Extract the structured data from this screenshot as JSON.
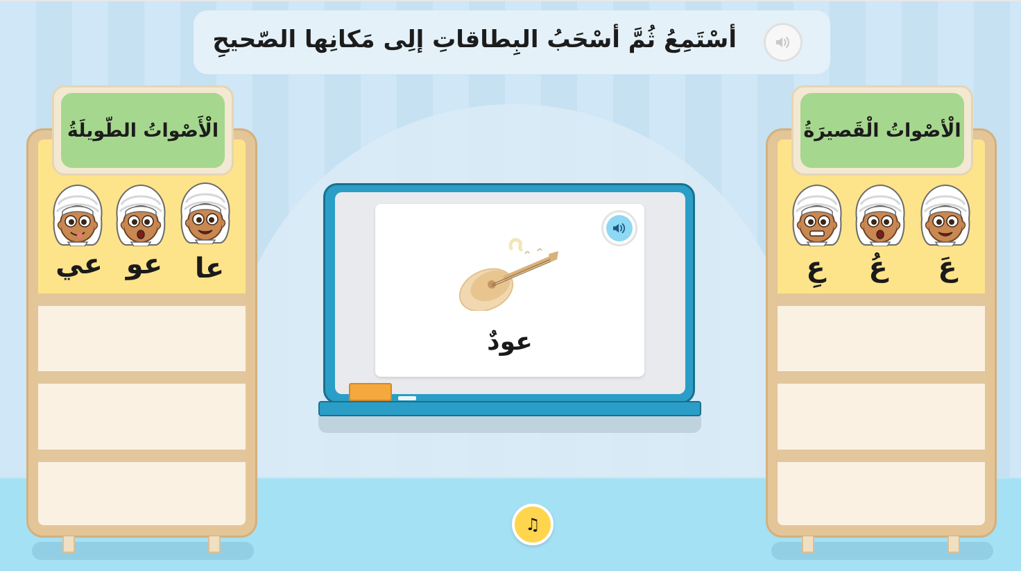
{
  "instruction": {
    "text": "أسْتَمِعُ ثُمَّ أسْحَبُ البِطاقاتِ إلِى مَكانِها الصّحيحِ",
    "audio_icon": "speaker-icon"
  },
  "long_sounds": {
    "title": "الْأَصْواتُ الطّويلَةُ",
    "sounds": [
      {
        "label": "عا",
        "face": "smiling-boy-face"
      },
      {
        "label": "عو",
        "face": "surprised-boy-face"
      },
      {
        "label": "عي",
        "face": "tongue-out-boy-face"
      }
    ],
    "slots": 3
  },
  "short_sounds": {
    "title": "الْأصْواتُ الْقَصيرَةُ",
    "sounds": [
      {
        "label": "عَ",
        "face": "smiling-boy-face"
      },
      {
        "label": "عُ",
        "face": "surprised-boy-face"
      },
      {
        "label": "عِ",
        "face": "grinning-boy-face"
      }
    ],
    "slots": 3
  },
  "card": {
    "word": "عودٌ",
    "image": "oud-instrument",
    "audio_icon": "speaker-icon"
  },
  "music_button": {
    "icon": "music-note-icon",
    "glyph": "♫"
  },
  "colors": {
    "sign_green": "#a6d78e",
    "shelf_yellow": "#fde38a",
    "board_blue": "#2a9ec6",
    "music_yellow": "#ffd54d"
  }
}
